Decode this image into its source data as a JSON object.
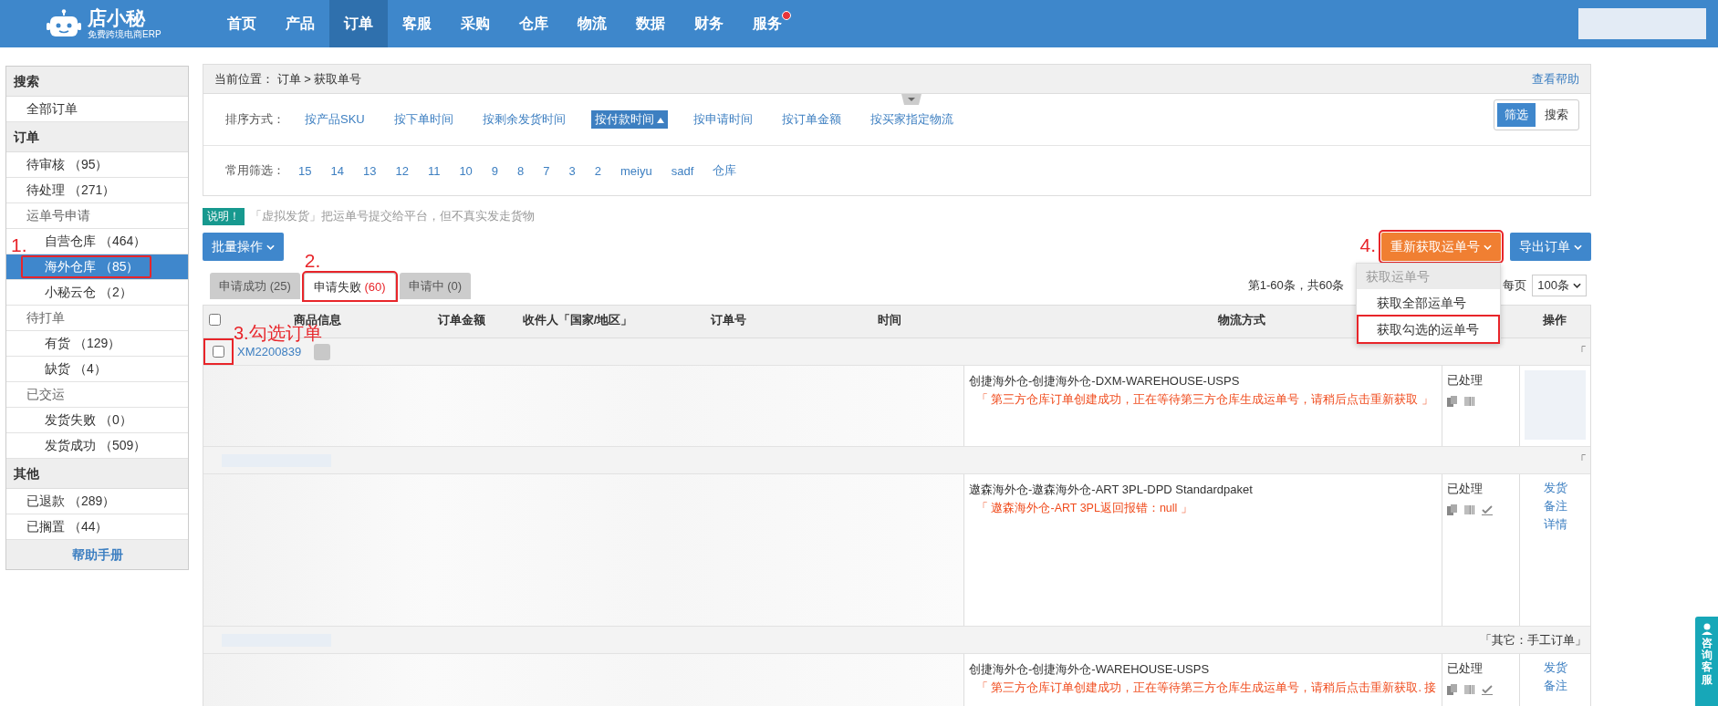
{
  "header": {
    "logo": {
      "name": "店小秘",
      "tagline": "免费跨境电商ERP"
    },
    "nav": [
      {
        "label": "首页",
        "selected": false,
        "dot": false
      },
      {
        "label": "产品",
        "selected": false,
        "dot": false
      },
      {
        "label": "订单",
        "selected": true,
        "dot": false
      },
      {
        "label": "客服",
        "selected": false,
        "dot": false
      },
      {
        "label": "采购",
        "selected": false,
        "dot": false
      },
      {
        "label": "仓库",
        "selected": false,
        "dot": false
      },
      {
        "label": "物流",
        "selected": false,
        "dot": false
      },
      {
        "label": "数据",
        "selected": false,
        "dot": false
      },
      {
        "label": "财务",
        "selected": false,
        "dot": false
      },
      {
        "label": "服务",
        "selected": false,
        "dot": true
      }
    ]
  },
  "sidebar": {
    "sections": [
      {
        "title": "搜索",
        "items": [
          {
            "label": "全部订单",
            "selected": false
          }
        ]
      },
      {
        "title": "订单",
        "items": [
          {
            "label": "待审核 （95）",
            "selected": false
          },
          {
            "label": "待处理 （271）",
            "selected": false
          },
          {
            "label": "运单号申请",
            "selected": false,
            "children": [
              {
                "label": "自营仓库 （464）",
                "selected": false
              },
              {
                "label": "海外仓库 （85）",
                "selected": true,
                "step": "1."
              },
              {
                "label": "小秘云仓 （2）",
                "selected": false
              }
            ]
          },
          {
            "label": "待打单",
            "selected": false,
            "children": [
              {
                "label": "有货 （129）",
                "selected": false
              },
              {
                "label": "缺货 （4）",
                "selected": false
              }
            ]
          },
          {
            "label": "已交运",
            "selected": false,
            "children": [
              {
                "label": "发货失败 （0）",
                "selected": false
              },
              {
                "label": "发货成功 （509）",
                "selected": false
              }
            ]
          }
        ]
      },
      {
        "title": "其他",
        "items": [
          {
            "label": "已退款 （289）",
            "selected": false
          },
          {
            "label": "已搁置 （44）",
            "selected": false
          }
        ]
      }
    ],
    "help_link": "帮助手册"
  },
  "breadcrumb": {
    "label": "当前位置：",
    "path": "订单 > 获取单号",
    "help": "查看帮助"
  },
  "filters": {
    "sort_label": "排序方式：",
    "sort_options": [
      {
        "label": "按产品SKU",
        "selected": false
      },
      {
        "label": "按下单时间",
        "selected": false
      },
      {
        "label": "按剩余发货时间",
        "selected": false
      },
      {
        "label": "按付款时间",
        "selected": true
      },
      {
        "label": "按申请时间",
        "selected": false
      },
      {
        "label": "按订单金额",
        "selected": false
      },
      {
        "label": "按买家指定物流",
        "selected": false
      }
    ],
    "mode": [
      {
        "label": "筛选",
        "selected": true
      },
      {
        "label": "搜索",
        "selected": false
      }
    ],
    "common_label": "常用筛选：",
    "common_options": [
      "15",
      "14",
      "13",
      "12",
      "11",
      "10",
      "9",
      "8",
      "7",
      "3",
      "2",
      "meiyu",
      "sadf",
      "仓库"
    ]
  },
  "notice": {
    "badge": "说明！",
    "text": "「虚拟发货」把运单号提交给平台，但不真实发走货物"
  },
  "toolbar": {
    "batch": "批量操作",
    "refetch": {
      "label": "重新获取运单号",
      "step": "4."
    },
    "export": "导出订单",
    "menu": {
      "header": "获取运单号",
      "items": [
        {
          "label": "获取全部运单号",
          "marked": false
        },
        {
          "label": "获取勾选的运单号",
          "marked": true
        }
      ]
    }
  },
  "tabs": [
    {
      "label": "申请成功",
      "count": "(25)",
      "selected": false
    },
    {
      "label": "申请失败",
      "count": "(60)",
      "selected": true,
      "step": "2."
    },
    {
      "label": "申请中",
      "count": "(0)",
      "selected": false
    }
  ],
  "pagination": {
    "summary": "第1-60条，共60条",
    "per_page_label": "每页",
    "per_page": "100条"
  },
  "table": {
    "select_all": false,
    "columns": [
      "商品信息",
      "订单金额",
      "收件人「国家/地区」",
      "订单号",
      "时间",
      "物流方式",
      "操作"
    ],
    "orders": [
      {
        "order_no": "XM2200839",
        "checked": false,
        "step": "3.勾选订单",
        "note": "「",
        "logistics": "创捷海外仓-创捷海外仓-DXM-WAREHOUSE-USPS",
        "message": "「 第三方仓库订单创建成功，正在等待第三方仓库生成运单号，请稍后点击重新获取 」",
        "status": "已处理",
        "check_mark": false
      },
      {
        "note": "「",
        "logistics": "遨森海外仓-遨森海外仓-ART 3PL-DPD Standardpaket",
        "message": "「 遨森海外仓-ART 3PL返回报错：null 」",
        "status": "已处理",
        "check_mark": true,
        "actions": [
          "发货",
          "备注",
          "详情"
        ]
      },
      {
        "note": "「其它：手工订单」",
        "logistics": "创捷海外仓-创捷海外仓-WAREHOUSE-USPS",
        "message": "「 第三方仓库订单创建成功，正在等待第三方仓库生成运单号，请稍后点击重新获取. 接",
        "status": "已处理",
        "check_mark": true,
        "actions": [
          "发货",
          "备注"
        ]
      }
    ]
  },
  "support_button": "咨询客服"
}
